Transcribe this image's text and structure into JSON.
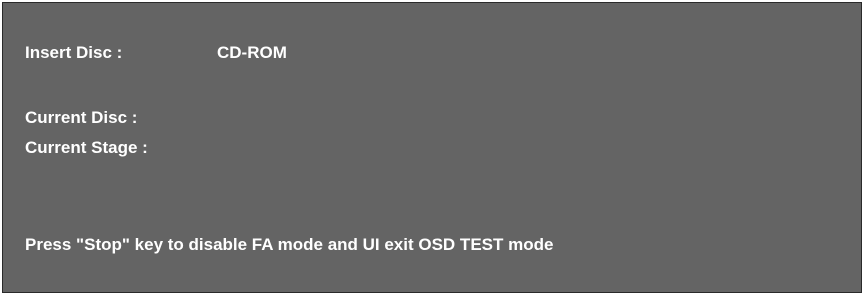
{
  "osd": {
    "insert_disc": {
      "label": "Insert Disc :",
      "value": "CD-ROM"
    },
    "current_disc": {
      "label": "Current Disc :",
      "value": ""
    },
    "current_stage": {
      "label": "Current Stage :",
      "value": ""
    },
    "instruction": "Press \"Stop\" key to disable FA mode and UI exit OSD TEST mode"
  },
  "colors": {
    "background": "#646464",
    "text": "#ffffff",
    "border": "#2a2a2a"
  }
}
